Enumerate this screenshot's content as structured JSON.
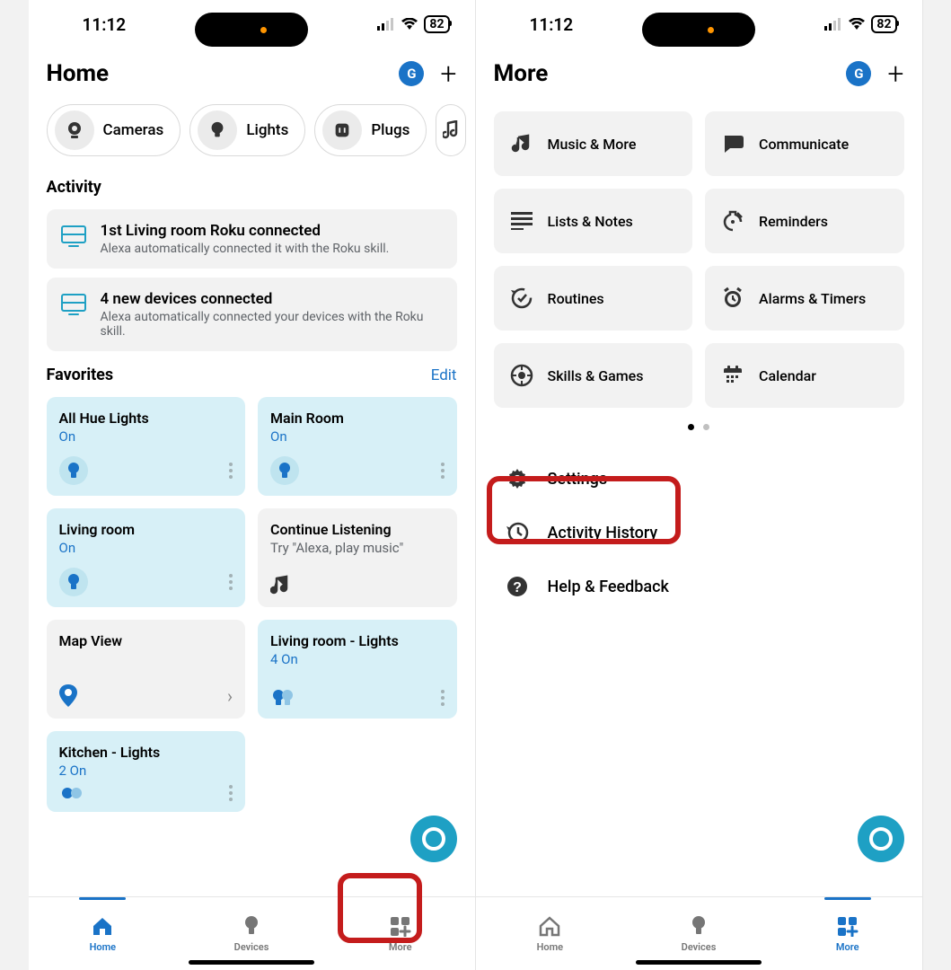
{
  "status": {
    "time": "11:12",
    "battery": "82"
  },
  "avatar_letter": "G",
  "left": {
    "title": "Home",
    "chips": [
      {
        "label": "Cameras"
      },
      {
        "label": "Lights"
      },
      {
        "label": "Plugs"
      }
    ],
    "activity_heading": "Activity",
    "activity": [
      {
        "title": "1st Living room Roku connected",
        "subtitle": "Alexa automatically connected it with the Roku skill."
      },
      {
        "title": "4 new devices connected",
        "subtitle": "Alexa automatically connected your devices with the Roku skill."
      }
    ],
    "favorites_heading": "Favorites",
    "edit_label": "Edit",
    "favorites": [
      {
        "title": "All Hue Lights",
        "status": "On",
        "on": true
      },
      {
        "title": "Main Room",
        "status": "On",
        "on": true
      },
      {
        "title": "Living room",
        "status": "On",
        "on": true
      },
      {
        "title": "Continue Listening",
        "status": "Try \"Alexa, play music\"",
        "on": false,
        "icon": "music"
      },
      {
        "title": "Map View",
        "status": "",
        "on": false,
        "icon": "pin",
        "chevron": true
      },
      {
        "title": "Living room - Lights",
        "status": "4 On",
        "on": true,
        "multi": true
      },
      {
        "title": "Kitchen - Lights",
        "status": "2 On",
        "on": true,
        "multi": true
      }
    ],
    "tabs": {
      "home": "Home",
      "devices": "Devices",
      "more": "More"
    }
  },
  "right": {
    "title": "More",
    "tiles": [
      {
        "label": "Music & More",
        "icon": "music"
      },
      {
        "label": "Communicate",
        "icon": "chat"
      },
      {
        "label": "Lists & Notes",
        "icon": "list"
      },
      {
        "label": "Reminders",
        "icon": "reminder"
      },
      {
        "label": "Routines",
        "icon": "routine"
      },
      {
        "label": "Alarms & Timers",
        "icon": "alarm"
      },
      {
        "label": "Skills & Games",
        "icon": "skill"
      },
      {
        "label": "Calendar",
        "icon": "calendar"
      }
    ],
    "rows": [
      {
        "label": "Settings",
        "icon": "gear"
      },
      {
        "label": "Activity History",
        "icon": "history"
      },
      {
        "label": "Help & Feedback",
        "icon": "help"
      }
    ],
    "tabs": {
      "home": "Home",
      "devices": "Devices",
      "more": "More"
    }
  }
}
